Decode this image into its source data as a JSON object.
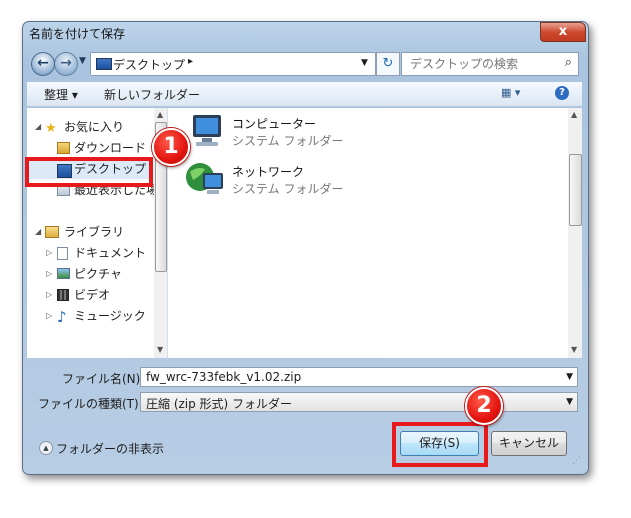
{
  "window": {
    "title": "名前を付けて保存",
    "close_label": "x"
  },
  "nav": {
    "back_glyph": "←",
    "forward_glyph": "→",
    "address_text": "デスクトップ",
    "address_arrow": "▸",
    "refresh_glyph": "↻",
    "search_placeholder": "デスクトップの検索"
  },
  "toolbar": {
    "organize": "整理 ▾",
    "new_folder": "新しいフォルダー",
    "views": "▦ ▾",
    "help": "?"
  },
  "sidebar": {
    "items": [
      {
        "label": "お気に入り",
        "icon": "star-icon"
      },
      {
        "label": "ダウンロード",
        "icon": "download-folder-icon"
      },
      {
        "label": "デスクトップ",
        "icon": "desktop-icon"
      },
      {
        "label": "最近表示した場所",
        "icon": "recent-places-icon"
      },
      {
        "label": "ライブラリ",
        "icon": "library-icon"
      },
      {
        "label": "ドキュメント",
        "icon": "documents-icon"
      },
      {
        "label": "ピクチャ",
        "icon": "pictures-icon"
      },
      {
        "label": "ビデオ",
        "icon": "videos-icon"
      },
      {
        "label": "ミュージック",
        "icon": "music-icon"
      }
    ]
  },
  "files": [
    {
      "name": "コンピューター",
      "type": "システム フォルダー",
      "icon": "computer-icon"
    },
    {
      "name": "ネットワーク",
      "type": "システム フォルダー",
      "icon": "network-icon"
    }
  ],
  "form": {
    "filename_label": "ファイル名(N):",
    "filename_value": "fw_wrc-733febk_v1.02.zip",
    "filetype_label": "ファイルの種類(T):",
    "filetype_value": "圧縮 (zip 形式) フォルダー"
  },
  "footer": {
    "hide_folders": "フォルダーの非表示",
    "save": "保存(S)",
    "cancel": "キャンセル"
  },
  "annotations": {
    "badge1": "1",
    "badge2": "2"
  },
  "colors": {
    "annotation_red": "#e8181b",
    "window_frame": "#a9c4df",
    "save_button": "#bee6fd"
  }
}
